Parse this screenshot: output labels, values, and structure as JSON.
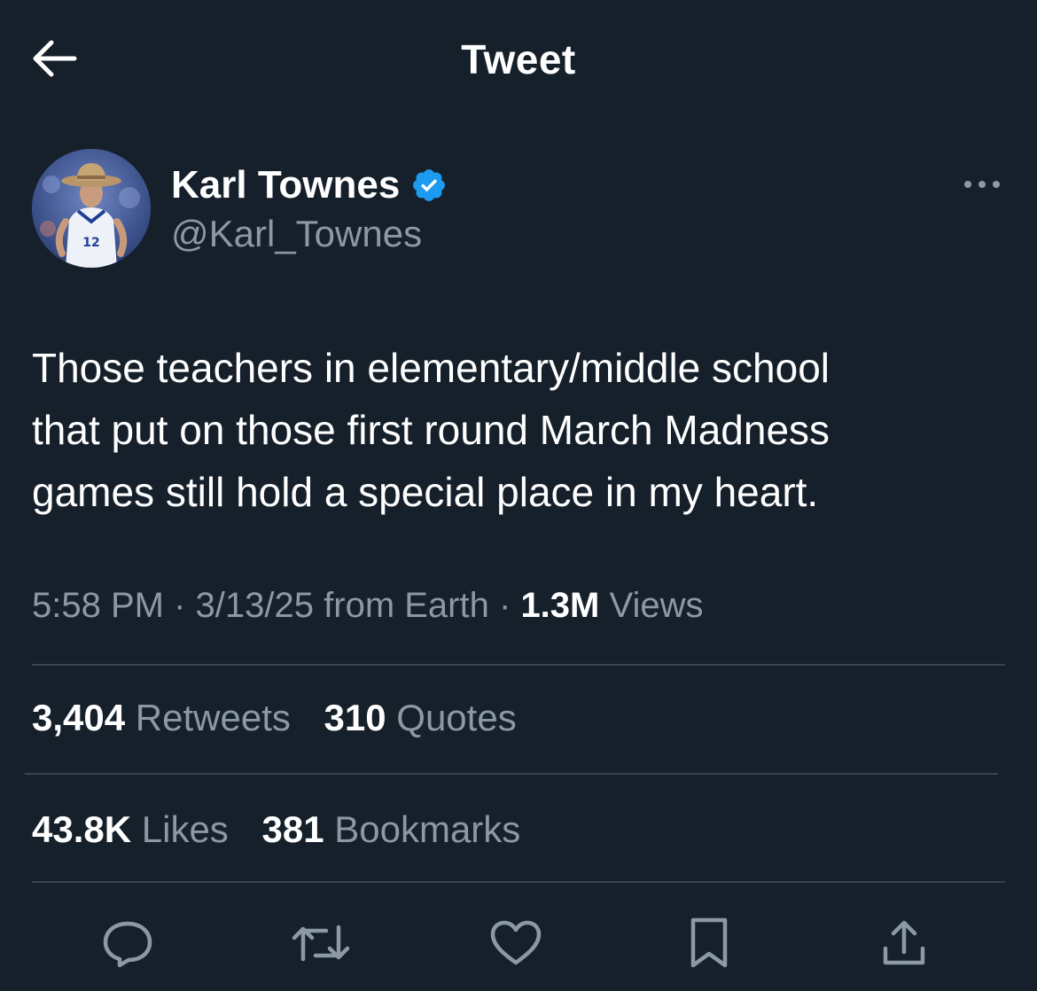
{
  "header": {
    "title": "Tweet",
    "back_icon": "arrow-left-icon"
  },
  "author": {
    "name": "Karl Townes",
    "handle": "@Karl_Townes",
    "verified": true,
    "verified_color": "#1d9bf0",
    "more_icon": "more-horizontal-icon"
  },
  "tweet": {
    "lines": [
      "Those teachers in elementary/middle school",
      "that put on those first round March Madness",
      "games still hold a special place in my heart."
    ]
  },
  "meta": {
    "time": "5:58 PM",
    "date": "3/13/25",
    "source": "from Earth",
    "views_count": "1.3M",
    "views_label": "Views",
    "separator": "·"
  },
  "stats": {
    "retweets_count": "3,404",
    "retweets_label": "Retweets",
    "quotes_count": "310",
    "quotes_label": "Quotes",
    "likes_count": "43.8K",
    "likes_label": "Likes",
    "bookmarks_count": "381",
    "bookmarks_label": "Bookmarks"
  },
  "actions": [
    {
      "name": "reply",
      "icon": "reply-icon"
    },
    {
      "name": "retweet",
      "icon": "retweet-icon"
    },
    {
      "name": "like",
      "icon": "heart-icon"
    },
    {
      "name": "bookmark",
      "icon": "bookmark-icon"
    },
    {
      "name": "share",
      "icon": "share-icon"
    }
  ],
  "colors": {
    "background": "#15202b",
    "primary_text": "#ffffff",
    "secondary_text": "#8b98a5",
    "divider": "#38444d"
  }
}
